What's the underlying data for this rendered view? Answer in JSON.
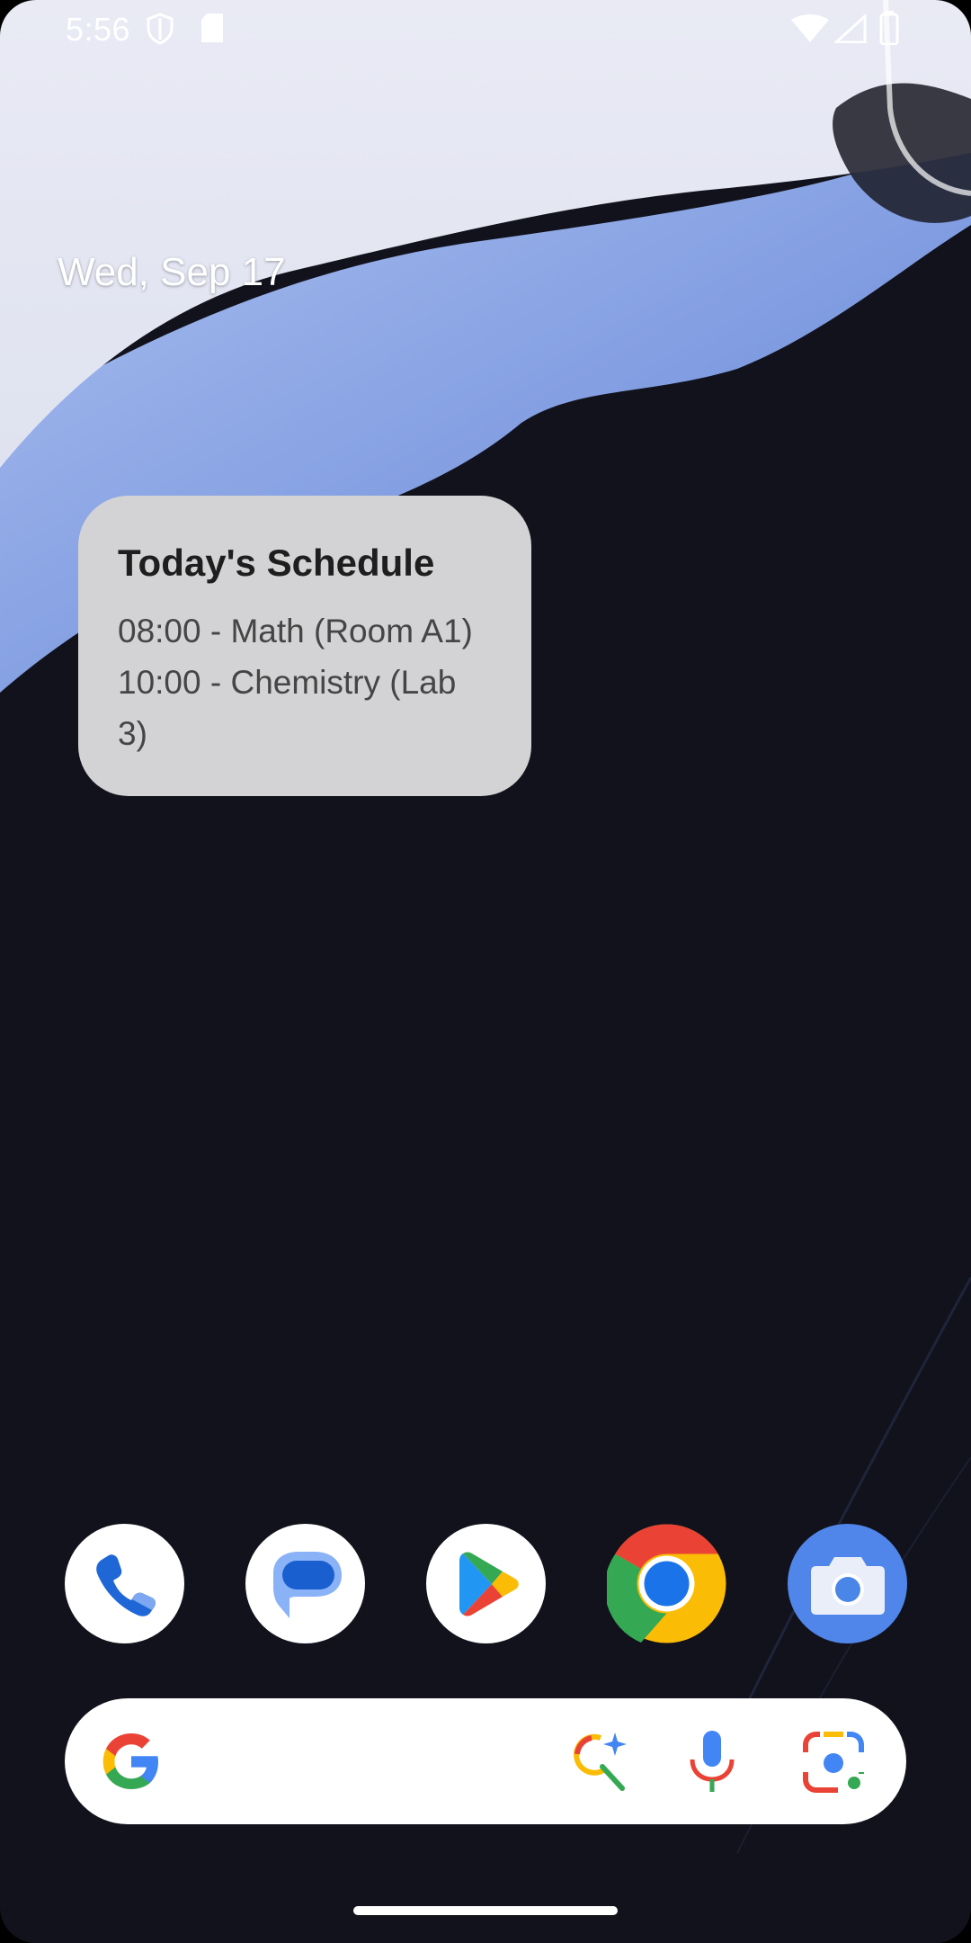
{
  "status_bar": {
    "time": "5:56",
    "icons": [
      "shield-icon",
      "sd-card-icon",
      "wifi-icon",
      "cell-signal-icon",
      "battery-icon"
    ]
  },
  "home": {
    "date": "Wed, Sep 17"
  },
  "widget": {
    "title": "Today's Schedule",
    "items": [
      "08:00 - Math (Room A1)",
      "10:00 - Chemistry (Lab",
      "3)"
    ]
  },
  "dock": {
    "apps": [
      "phone-app-icon",
      "messages-app-icon",
      "play-store-app-icon",
      "chrome-app-icon",
      "camera-app-icon"
    ]
  },
  "search_bar": {
    "icons": [
      "google-g-icon",
      "ai-search-icon",
      "microphone-icon",
      "google-lens-icon"
    ]
  },
  "colors": {
    "wallpaper_dark": "#12121c",
    "wallpaper_light": "#e8e9f3",
    "wallpaper_blue": "#8aa6e4",
    "widget_bg": "#d3d3d5",
    "google_blue": "#4285f4",
    "google_red": "#ea4335",
    "google_yellow": "#fbbc05",
    "google_green": "#34a853"
  }
}
